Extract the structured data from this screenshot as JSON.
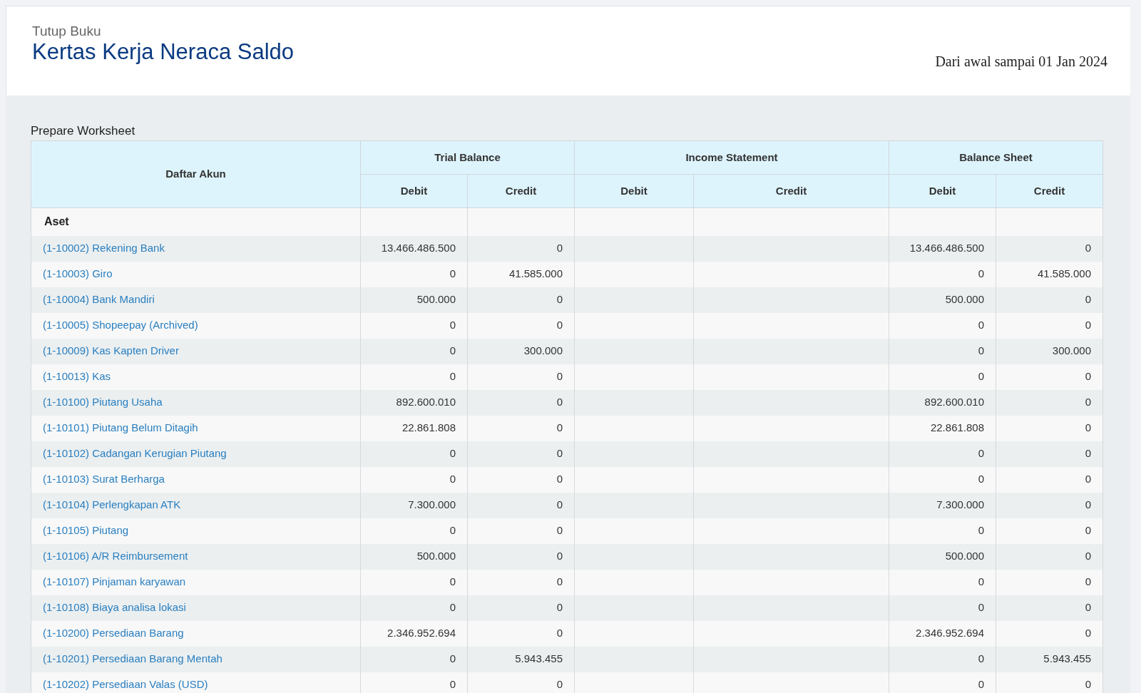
{
  "header": {
    "breadcrumb": "Tutup Buku",
    "title": "Kertas Kerja Neraca Saldo",
    "period": "Dari awal sampai 01 Jan 2024"
  },
  "worksheet": {
    "title": "Prepare Worksheet",
    "account_column": "Daftar Akun",
    "groups": [
      {
        "label": "Trial Balance",
        "columns": [
          "Debit",
          "Credit"
        ]
      },
      {
        "label": "Income Statement",
        "columns": [
          "Debit",
          "Credit"
        ]
      },
      {
        "label": "Balance Sheet",
        "columns": [
          "Debit",
          "Credit"
        ]
      }
    ],
    "sections": [
      {
        "label": "Aset",
        "rows": [
          {
            "account": "(1-10002) Rekening Bank",
            "trial_balance": [
              "13.466.486.500",
              "0"
            ],
            "balance_sheet": [
              "13.466.486.500",
              "0"
            ]
          },
          {
            "account": "(1-10003) Giro",
            "trial_balance": [
              "0",
              "41.585.000"
            ],
            "balance_sheet": [
              "0",
              "41.585.000"
            ]
          },
          {
            "account": "(1-10004) Bank Mandiri",
            "trial_balance": [
              "500.000",
              "0"
            ],
            "balance_sheet": [
              "500.000",
              "0"
            ]
          },
          {
            "account": "(1-10005) Shopeepay (Archived)",
            "trial_balance": [
              "0",
              "0"
            ],
            "balance_sheet": [
              "0",
              "0"
            ]
          },
          {
            "account": "(1-10009) Kas Kapten Driver",
            "trial_balance": [
              "0",
              "300.000"
            ],
            "balance_sheet": [
              "0",
              "300.000"
            ]
          },
          {
            "account": "(1-10013) Kas",
            "trial_balance": [
              "0",
              "0"
            ],
            "balance_sheet": [
              "0",
              "0"
            ]
          },
          {
            "account": "(1-10100) Piutang Usaha",
            "trial_balance": [
              "892.600.010",
              "0"
            ],
            "balance_sheet": [
              "892.600.010",
              "0"
            ]
          },
          {
            "account": "(1-10101) Piutang Belum Ditagih",
            "trial_balance": [
              "22.861.808",
              "0"
            ],
            "balance_sheet": [
              "22.861.808",
              "0"
            ]
          },
          {
            "account": "(1-10102) Cadangan Kerugian Piutang",
            "trial_balance": [
              "0",
              "0"
            ],
            "balance_sheet": [
              "0",
              "0"
            ]
          },
          {
            "account": "(1-10103) Surat Berharga",
            "trial_balance": [
              "0",
              "0"
            ],
            "balance_sheet": [
              "0",
              "0"
            ]
          },
          {
            "account": "(1-10104) Perlengkapan ATK",
            "trial_balance": [
              "7.300.000",
              "0"
            ],
            "balance_sheet": [
              "7.300.000",
              "0"
            ]
          },
          {
            "account": "(1-10105) Piutang",
            "trial_balance": [
              "0",
              "0"
            ],
            "balance_sheet": [
              "0",
              "0"
            ]
          },
          {
            "account": "(1-10106) A/R Reimbursement",
            "trial_balance": [
              "500.000",
              "0"
            ],
            "balance_sheet": [
              "500.000",
              "0"
            ]
          },
          {
            "account": "(1-10107) Pinjaman karyawan",
            "trial_balance": [
              "0",
              "0"
            ],
            "balance_sheet": [
              "0",
              "0"
            ]
          },
          {
            "account": "(1-10108) Biaya analisa lokasi",
            "trial_balance": [
              "0",
              "0"
            ],
            "balance_sheet": [
              "0",
              "0"
            ]
          },
          {
            "account": "(1-10200) Persediaan Barang",
            "trial_balance": [
              "2.346.952.694",
              "0"
            ],
            "balance_sheet": [
              "2.346.952.694",
              "0"
            ]
          },
          {
            "account": "(1-10201) Persediaan Barang Mentah",
            "trial_balance": [
              "0",
              "5.943.455"
            ],
            "balance_sheet": [
              "0",
              "5.943.455"
            ]
          },
          {
            "account": "(1-10202) Persediaan Valas (USD)",
            "trial_balance": [
              "0",
              "0"
            ],
            "balance_sheet": [
              "0",
              "0"
            ]
          }
        ]
      }
    ]
  }
}
